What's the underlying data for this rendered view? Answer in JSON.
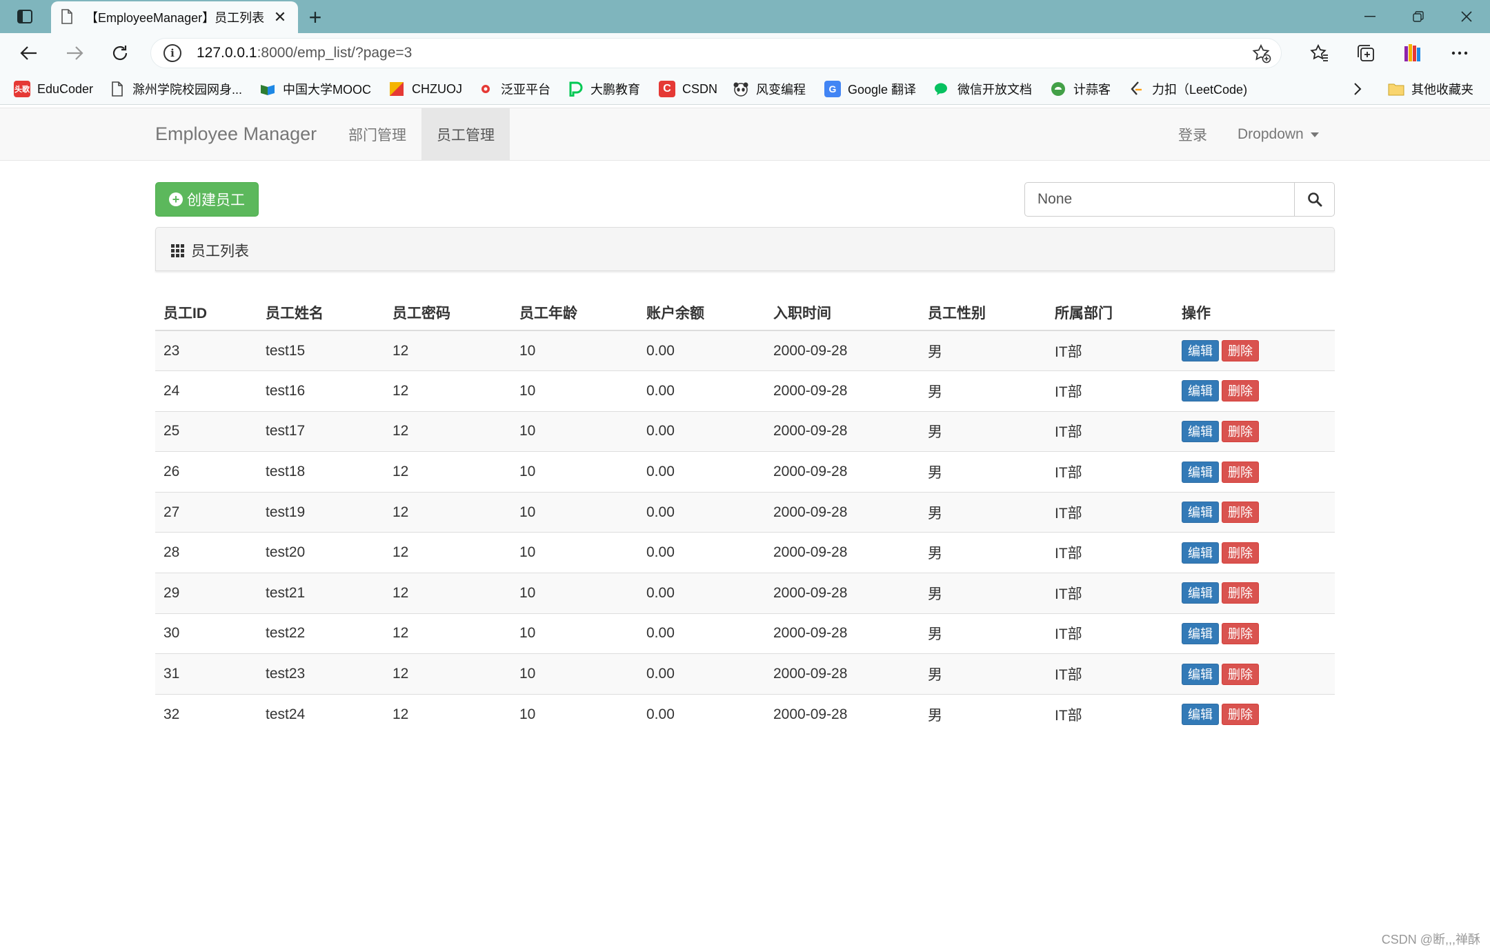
{
  "browser": {
    "tab_title": "【EmployeeManager】员工列表",
    "url_host": "127.0.0.1",
    "url_rest": ":8000/emp_list/?page=3",
    "bookmarks": [
      {
        "label": "EduCoder",
        "badge": "头歌",
        "color": "#e53935"
      },
      {
        "label": "滁州学院校园网身...",
        "badge": "",
        "color": "#ffffff"
      },
      {
        "label": "中国大学MOOC",
        "badge": "",
        "color": "#2e7d32"
      },
      {
        "label": "CHZUOJ",
        "badge": "",
        "color": "#f4b400"
      },
      {
        "label": "泛亚平台",
        "badge": "",
        "color": "#e53935"
      },
      {
        "label": "大鹏教育",
        "badge": "",
        "color": "#00c853"
      },
      {
        "label": "CSDN",
        "badge": "C",
        "color": "#e53935"
      },
      {
        "label": "风变编程",
        "badge": "",
        "color": "#424242"
      },
      {
        "label": "Google 翻译",
        "badge": "G",
        "color": "#4285f4"
      },
      {
        "label": "微信开放文档",
        "badge": "",
        "color": "#07c160"
      },
      {
        "label": "计蒜客",
        "badge": "",
        "color": "#43a047"
      },
      {
        "label": "力扣（LeetCode)",
        "badge": "",
        "color": "#ffa116"
      }
    ],
    "other_bookmarks": "其他收藏夹"
  },
  "nav": {
    "brand": "Employee Manager",
    "links": [
      "部门管理",
      "员工管理"
    ],
    "login": "登录",
    "dropdown": "Dropdown"
  },
  "actions": {
    "create_label": "创建员工",
    "search_value": "None"
  },
  "panel": {
    "title": "员工列表"
  },
  "table": {
    "headers": [
      "员工ID",
      "员工姓名",
      "员工密码",
      "员工年龄",
      "账户余额",
      "入职时间",
      "员工性别",
      "所属部门",
      "操作"
    ],
    "edit_label": "编辑",
    "delete_label": "删除",
    "rows": [
      [
        "23",
        "test15",
        "12",
        "10",
        "0.00",
        "2000-09-28",
        "男",
        "IT部"
      ],
      [
        "24",
        "test16",
        "12",
        "10",
        "0.00",
        "2000-09-28",
        "男",
        "IT部"
      ],
      [
        "25",
        "test17",
        "12",
        "10",
        "0.00",
        "2000-09-28",
        "男",
        "IT部"
      ],
      [
        "26",
        "test18",
        "12",
        "10",
        "0.00",
        "2000-09-28",
        "男",
        "IT部"
      ],
      [
        "27",
        "test19",
        "12",
        "10",
        "0.00",
        "2000-09-28",
        "男",
        "IT部"
      ],
      [
        "28",
        "test20",
        "12",
        "10",
        "0.00",
        "2000-09-28",
        "男",
        "IT部"
      ],
      [
        "29",
        "test21",
        "12",
        "10",
        "0.00",
        "2000-09-28",
        "男",
        "IT部"
      ],
      [
        "30",
        "test22",
        "12",
        "10",
        "0.00",
        "2000-09-28",
        "男",
        "IT部"
      ],
      [
        "31",
        "test23",
        "12",
        "10",
        "0.00",
        "2000-09-28",
        "男",
        "IT部"
      ],
      [
        "32",
        "test24",
        "12",
        "10",
        "0.00",
        "2000-09-28",
        "男",
        "IT部"
      ]
    ]
  },
  "watermark": "CSDN @断,,,禅酥"
}
